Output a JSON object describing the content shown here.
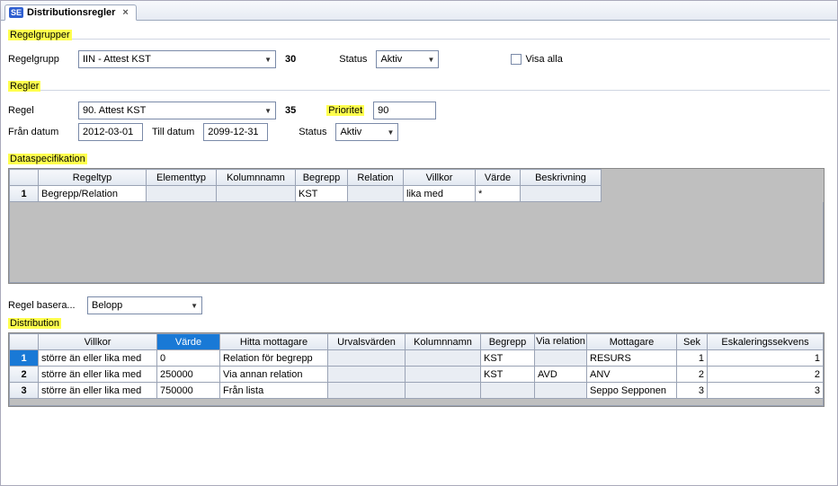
{
  "tab": {
    "badge": "SE",
    "title": "Distributionsregler",
    "close": "×"
  },
  "regelgrupper": {
    "title": "Regelgrupper",
    "regelgrupp_label": "Regelgrupp",
    "regelgrupp_value": "IIN - Attest KST",
    "regelgrupp_num": "30",
    "status_label": "Status",
    "status_value": "Aktiv",
    "visa_alla_label": "Visa alla"
  },
  "regler": {
    "title": "Regler",
    "regel_label": "Regel",
    "regel_value": "90. Attest KST",
    "regel_num": "35",
    "prioritet_label": "Prioritet",
    "prioritet_value": "90",
    "fran_label": "Från datum",
    "fran_value": "2012-03-01",
    "till_label": "Till datum",
    "till_value": "2099-12-31",
    "status_label": "Status",
    "status_value": "Aktiv"
  },
  "dataspec": {
    "title": "Dataspecifikation",
    "headers": [
      "",
      "Regeltyp",
      "Elementtyp",
      "Kolumnnamn",
      "Begrepp",
      "Relation",
      "Villkor",
      "Värde",
      "Beskrivning"
    ],
    "rows": [
      {
        "n": "1",
        "regeltyp": "Begrepp/Relation",
        "elementtyp": "",
        "kolumnnamn": "",
        "begrepp": "KST",
        "relation": "",
        "villkor": "lika med",
        "varde": "*",
        "beskrivning": ""
      }
    ]
  },
  "regelbasera": {
    "label": "Regel basera...",
    "value": "Belopp"
  },
  "distribution": {
    "title": "Distribution",
    "headers": [
      "",
      "Villkor",
      "Värde",
      "Hitta mottagare",
      "Urvalsvärden",
      "Kolumnnamn",
      "Begrepp",
      "Via relation",
      "Mottagare",
      "Sek",
      "Eskaleringssekvens"
    ],
    "rows": [
      {
        "n": "1",
        "villkor": "större än eller lika med",
        "varde": "0",
        "hitta": "Relation för begrepp",
        "urval": "",
        "kol": "",
        "begrepp": "KST",
        "via": "",
        "mottagare": "RESURS",
        "sek": "1",
        "esk": "1"
      },
      {
        "n": "2",
        "villkor": "större än eller lika med",
        "varde": "250000",
        "hitta": "Via annan relation",
        "urval": "",
        "kol": "",
        "begrepp": "KST",
        "via": "AVD",
        "mottagare": "ANV",
        "sek": "2",
        "esk": "2"
      },
      {
        "n": "3",
        "villkor": "större än eller lika med",
        "varde": "750000",
        "hitta": "Från lista",
        "urval": "",
        "kol": "",
        "begrepp": "",
        "via": "",
        "mottagare": "Seppo Sepponen",
        "sek": "3",
        "esk": "3"
      }
    ]
  }
}
